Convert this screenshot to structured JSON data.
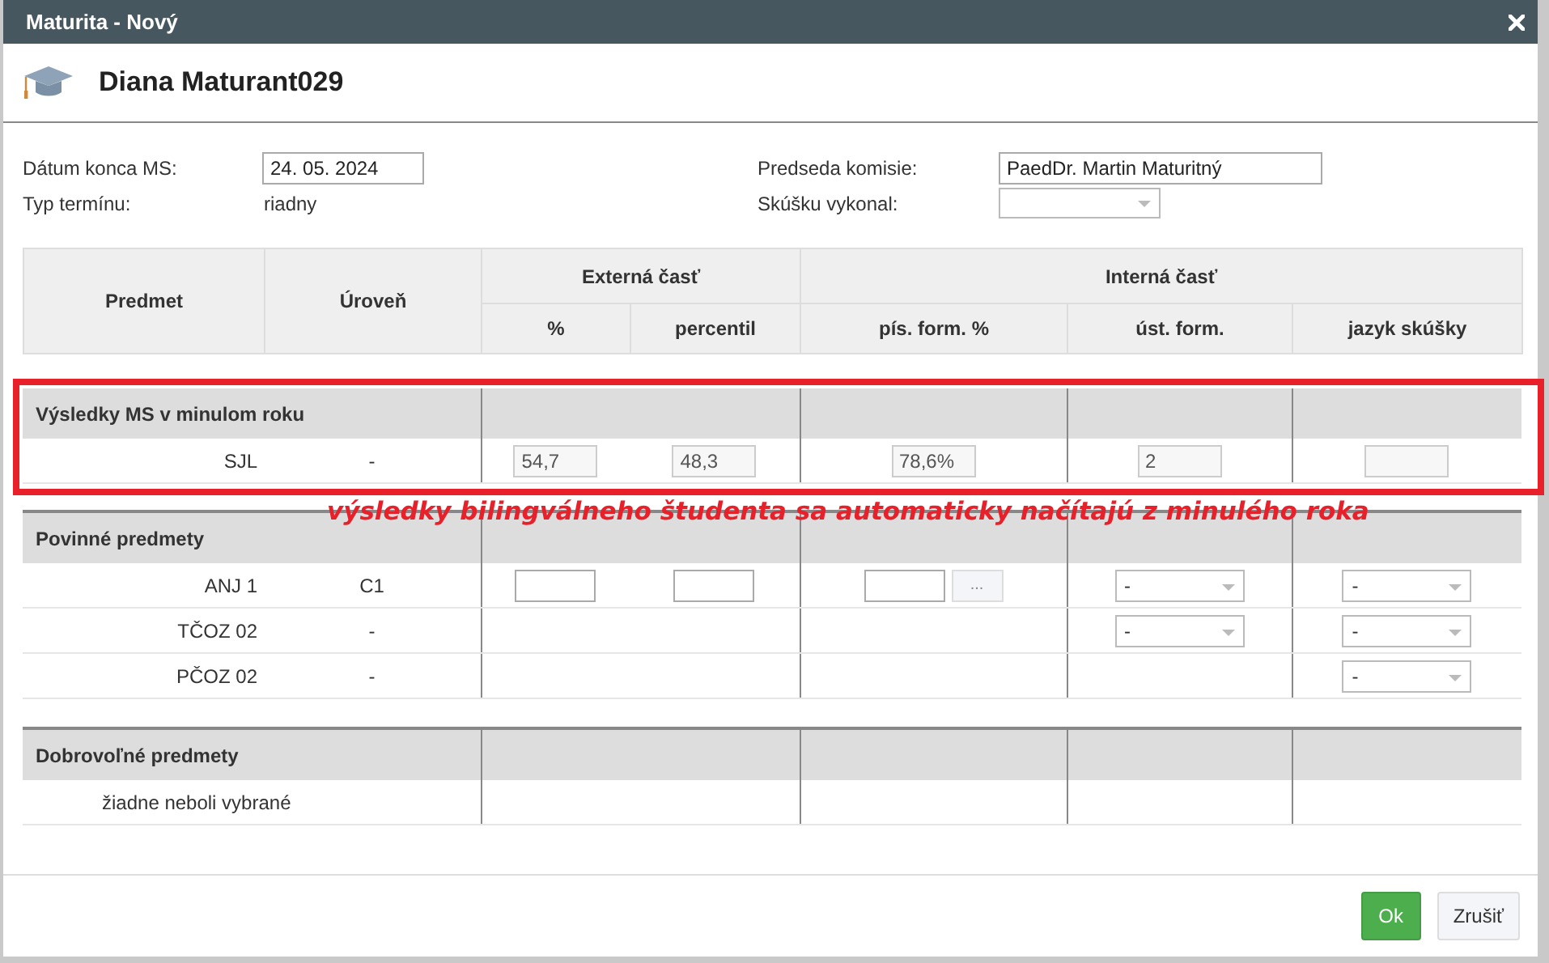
{
  "window": {
    "title": "Maturita - Nový"
  },
  "student": {
    "name": "Diana Maturant029"
  },
  "fields": [
    {
      "label": "Dátum konca MS:",
      "kind": "input",
      "value": "24. 05. 2024"
    },
    {
      "label": "Predseda komisie:",
      "kind": "input",
      "value": "PaedDr. Martin Maturitný"
    },
    {
      "label": "Typ termínu:",
      "kind": "text",
      "value": "riadny"
    },
    {
      "label": "Skúšku vykonal:",
      "kind": "select"
    }
  ],
  "table": {
    "columns": [
      "Predmet",
      "Úroveň"
    ],
    "groups": [
      {
        "label": "Externá časť",
        "columns": [
          "%",
          "percentil"
        ]
      },
      {
        "label": "Interná časť",
        "columns": [
          "pís. form. %",
          "úst. form.",
          "jazyk skúšky"
        ]
      }
    ],
    "sections": [
      {
        "title": "Výsledky MS v minulom roku",
        "highlighted": true,
        "rows": [
          {
            "kind": "subject",
            "subject": "SJL",
            "level": "-",
            "cells": [
              {
                "kind": "input",
                "value": "54,7",
                "disabled": true
              },
              {
                "kind": "input",
                "value": "48,3",
                "disabled": true
              },
              {
                "kind": "input",
                "value": "78,6%",
                "disabled": true
              },
              {
                "kind": "input",
                "value": "2",
                "disabled": true
              },
              {
                "kind": "input",
                "disabled": true
              }
            ]
          }
        ]
      },
      {
        "title": "Povinné predmety",
        "highlighted": false,
        "rows": [
          {
            "kind": "subject",
            "subject": "ANJ 1",
            "level": "C1",
            "cells": [
              {
                "kind": "input",
                "disabled": false
              },
              {
                "kind": "input",
                "disabled": false
              },
              {
                "kind": "input_button",
                "button": "..."
              },
              {
                "kind": "select",
                "value": "-"
              },
              {
                "kind": "select",
                "value": "-"
              }
            ]
          },
          {
            "kind": "subject",
            "subject": "TČOZ 02",
            "level": "-",
            "cells": [
              {
                "kind": "empty"
              },
              {
                "kind": "empty"
              },
              {
                "kind": "empty"
              },
              {
                "kind": "select",
                "value": "-"
              },
              {
                "kind": "select",
                "value": "-"
              }
            ]
          },
          {
            "kind": "subject",
            "subject": "PČOZ 02",
            "level": "-",
            "cells": [
              {
                "kind": "empty"
              },
              {
                "kind": "empty"
              },
              {
                "kind": "empty"
              },
              {
                "kind": "empty"
              },
              {
                "kind": "select",
                "value": "-"
              }
            ]
          }
        ]
      },
      {
        "title": "Dobrovoľné predmety",
        "highlighted": false,
        "rows": [
          {
            "kind": "note",
            "subject": "žiadne neboli vybrané"
          }
        ]
      }
    ]
  },
  "annotation": {
    "text": "výsledky bilingválneho študenta sa automaticky načítajú z minulého roka"
  },
  "buttons": [
    {
      "label": "Ok",
      "kind": "primary"
    },
    {
      "label": "Zrušiť",
      "kind": "secondary"
    }
  ]
}
